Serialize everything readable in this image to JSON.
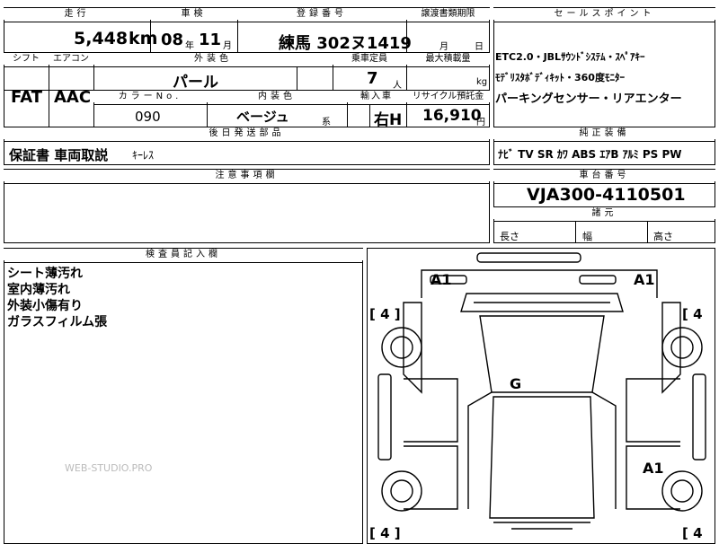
{
  "top_fragment": "",
  "mileage": {
    "header": "走行",
    "value": "5,448",
    "unit": "km"
  },
  "shaken": {
    "header": "車検",
    "year": "08",
    "year_unit": "年",
    "month": "11",
    "month_unit": "月"
  },
  "registration": {
    "header": "登録番号",
    "value": "練馬 302ヌ1419"
  },
  "transfer": {
    "header": "譲渡書類期限",
    "month_unit": "月",
    "day_unit": "日"
  },
  "sales_point": {
    "header": "セールスポイント",
    "lines": [
      "ETC2.0・JBLｻｳﾝﾄﾞｼｽﾃﾑ・ｽﾍﾟｱｷｰ",
      "ﾓﾃﾞﾘｽﾀﾎﾞﾃﾞｨｷｯﾄ・360度ﾓﾆﾀｰ",
      "パーキングセンサー・リアエンター"
    ]
  },
  "shift": {
    "header": "シフト",
    "value": "FAT"
  },
  "aircon": {
    "header": "エアコン",
    "value": "AAC"
  },
  "exterior_color": {
    "header": "外装色",
    "value": "パール"
  },
  "capacity": {
    "header": "乗車定員",
    "value": "7",
    "unit": "人"
  },
  "max_load": {
    "header": "最大積載量",
    "unit": "kg"
  },
  "color_no": {
    "header": "カラーNo.",
    "value": "090"
  },
  "interior_color": {
    "header": "内装色",
    "value": "ベージュ",
    "suffix": "系"
  },
  "import": {
    "header": "輸入車",
    "value": "右H"
  },
  "recycle": {
    "header": "リサイクル預託金",
    "value": "16,910",
    "unit": "円"
  },
  "later_parts": {
    "header": "後日発送部品",
    "value": "保証書 車両取説",
    "small": "ｷｰﾚｽ"
  },
  "genuine": {
    "header": "純正装備",
    "value": "ﾅﾋﾞ TV SR ｶﾜ ABS ｴｱB ｱﾙﾐ PS PW"
  },
  "caution": {
    "header": "注意事項欄"
  },
  "chassis": {
    "header": "車台番号",
    "value": "VJA300-4110501"
  },
  "dimensions": {
    "header": "諸元",
    "length": "長さ",
    "width": "幅",
    "height": "高さ"
  },
  "inspector": {
    "header": "検査員記入欄",
    "notes": [
      "シート薄汚れ",
      "室内薄汚れ",
      "外装小傷有り",
      "ガラスフィルム張"
    ]
  },
  "diagram": {
    "marks": [
      {
        "id": "a1-left",
        "text": "A1"
      },
      {
        "id": "a1-right",
        "text": "A1"
      },
      {
        "id": "g",
        "text": "G"
      },
      {
        "id": "a1-rear",
        "text": "A1"
      },
      {
        "id": "tl",
        "text": "[ 4 ]"
      },
      {
        "id": "tr",
        "text": "[ 4"
      },
      {
        "id": "bl",
        "text": "[ 4 ]"
      },
      {
        "id": "br",
        "text": "[ 4"
      }
    ]
  },
  "watermark": "WEB-STUDIO.PRO"
}
